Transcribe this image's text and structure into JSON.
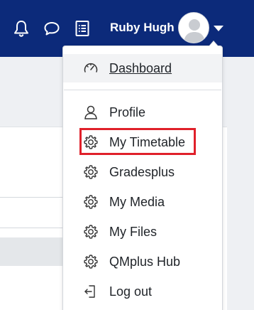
{
  "navbar": {
    "bg_color": "#0c2a7a",
    "icons": [
      "bell-icon",
      "chat-bubble-icon",
      "notes-icon"
    ],
    "user_name": "Ruby Hugh"
  },
  "dropdown": {
    "items": [
      {
        "label": "Dashboard",
        "icon": "speedometer-icon",
        "active": true
      },
      {
        "label": "Profile",
        "icon": "user-icon"
      },
      {
        "label": "My Timetable",
        "icon": "cog-icon",
        "highlighted": true
      },
      {
        "label": "Gradesplus",
        "icon": "cog-icon"
      },
      {
        "label": "My Media",
        "icon": "cog-icon"
      },
      {
        "label": "My Files",
        "icon": "cog-icon"
      },
      {
        "label": "QMplus Hub",
        "icon": "cog-icon"
      },
      {
        "label": "Log out",
        "icon": "sign-out-icon"
      }
    ],
    "highlight_color": "#e0202a"
  }
}
